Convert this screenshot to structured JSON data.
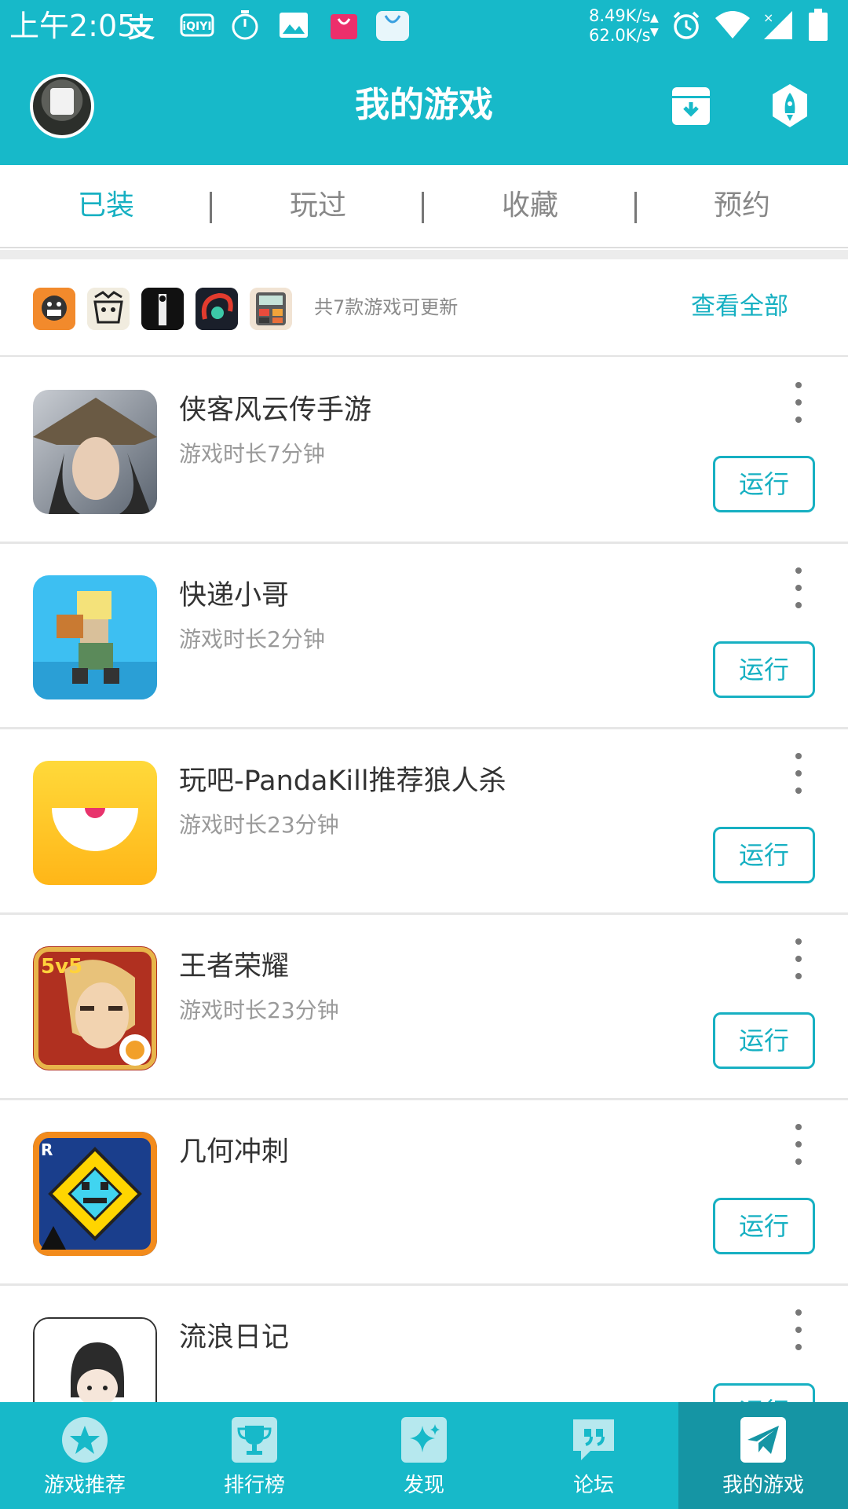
{
  "status_bar": {
    "time": "上午2:05",
    "net_up": "8.49K/s",
    "net_down": "62.0K/s",
    "icons": [
      "alipay-icon",
      "iqiyi-icon",
      "timer-icon",
      "gallery-icon",
      "shopping-bag-icon",
      "store-icon",
      "alarm-icon",
      "wifi-icon",
      "signal-icon",
      "battery-icon"
    ],
    "iqiyi_text": "iQIYI"
  },
  "header": {
    "title": "我的游戏",
    "icons": [
      "avatar",
      "download-box-icon",
      "rocket-icon"
    ]
  },
  "tabs": [
    {
      "label": "已装",
      "active": true
    },
    {
      "label": "玩过",
      "active": false
    },
    {
      "label": "收藏",
      "active": false
    },
    {
      "label": "预约",
      "active": false
    }
  ],
  "updates": {
    "text": "共7款游戏可更新",
    "view_all": "查看全部",
    "icons": [
      "update-game-icon-1",
      "update-game-icon-2",
      "update-game-icon-3",
      "update-game-icon-4",
      "update-game-icon-5"
    ]
  },
  "games": [
    {
      "name": "侠客风云传手游",
      "playtime": "游戏时长7分钟",
      "action": "运行"
    },
    {
      "name": "快递小哥",
      "playtime": "游戏时长2分钟",
      "action": "运行"
    },
    {
      "name": "玩吧-PandaKill推荐狼人杀",
      "playtime": "游戏时长23分钟",
      "action": "运行"
    },
    {
      "name": "王者荣耀",
      "playtime": "游戏时长23分钟",
      "action": "运行"
    },
    {
      "name": "几何冲刺",
      "playtime": "",
      "action": "运行"
    },
    {
      "name": "流浪日记",
      "playtime": "",
      "action": "运行"
    }
  ],
  "bottom_nav": [
    {
      "label": "游戏推荐",
      "icon": "star-icon",
      "active": false
    },
    {
      "label": "排行榜",
      "icon": "trophy-icon",
      "active": false
    },
    {
      "label": "发现",
      "icon": "sparkle-icon",
      "active": false
    },
    {
      "label": "论坛",
      "icon": "quote-icon",
      "active": false
    },
    {
      "label": "我的游戏",
      "icon": "paper-plane-icon",
      "active": true
    }
  ],
  "colors": {
    "accent": "#17b9c9",
    "accent_text": "#17b0c2",
    "nav_active": "#1595a4"
  }
}
